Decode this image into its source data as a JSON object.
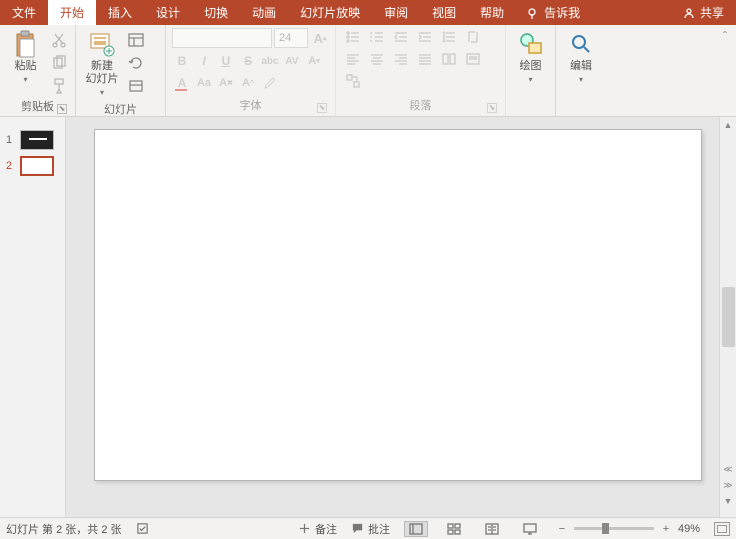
{
  "tabs": {
    "file": "文件",
    "home": "开始",
    "insert": "插入",
    "design": "设计",
    "transition": "切换",
    "animation": "动画",
    "slideshow": "幻灯片放映",
    "review": "审阅",
    "view": "视图",
    "help": "帮助",
    "tellme": "告诉我",
    "share": "共享"
  },
  "ribbon": {
    "clipboard": {
      "paste": "粘贴",
      "label": "剪贴板"
    },
    "slides": {
      "newSlide1": "新建",
      "newSlide2": "幻灯片",
      "label": "幻灯片"
    },
    "font": {
      "size": "24",
      "label": "字体"
    },
    "paragraph": {
      "label": "段落"
    },
    "drawing": {
      "btn": "绘图",
      "label": ""
    },
    "editing": {
      "btn": "编辑",
      "label": ""
    }
  },
  "thumbs": [
    {
      "n": "1"
    },
    {
      "n": "2"
    }
  ],
  "status": {
    "slideInfo": "幻灯片 第 2 张，共 2 张",
    "notes": "备注",
    "comments": "批注",
    "zoom": "49%"
  }
}
